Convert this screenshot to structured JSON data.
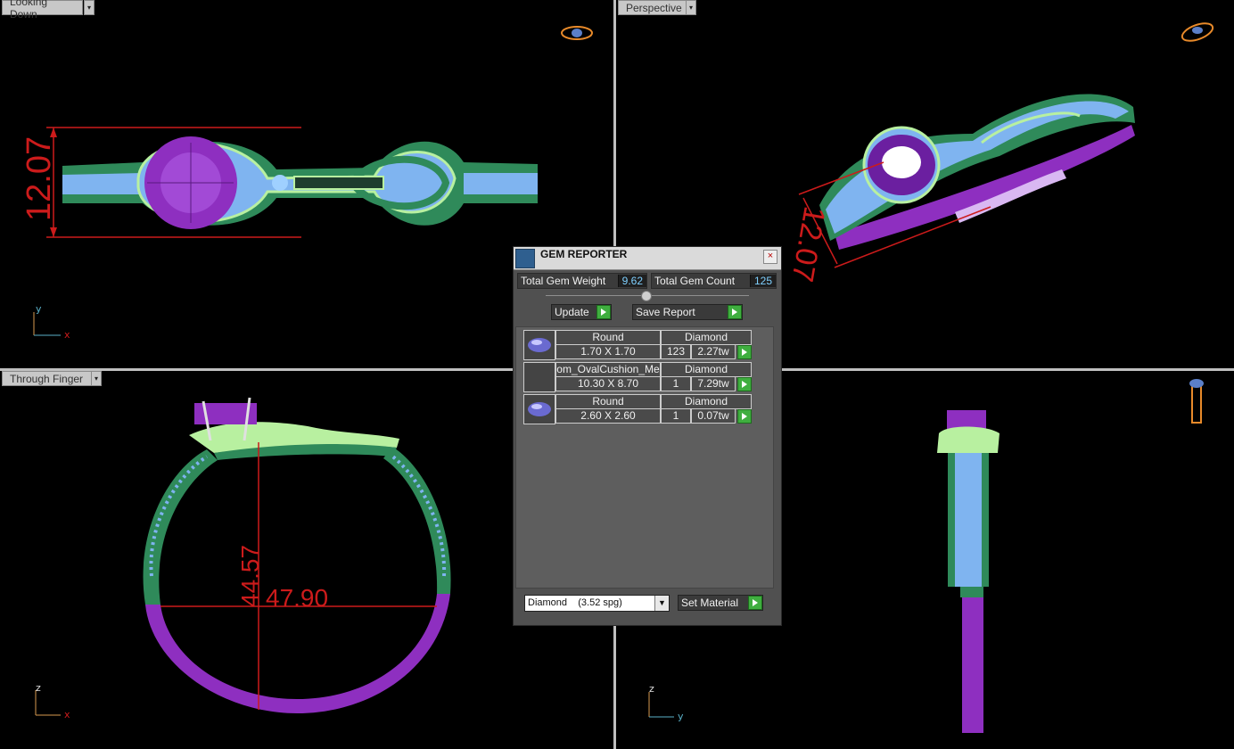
{
  "viewports": {
    "top_left": {
      "label": "Looking Down",
      "dimension": "12.07",
      "axis_a": "y",
      "axis_b": "x"
    },
    "top_right": {
      "label": "Perspective",
      "dimension": "12.07"
    },
    "bottom_left": {
      "label": "Through Finger",
      "dimension_height": "44.57",
      "dimension_width": "47.90",
      "axis_a": "z",
      "axis_b": "x"
    },
    "bottom_right": {
      "axis_a": "z",
      "axis_b": "y"
    }
  },
  "gem_reporter": {
    "title": "GEM REPORTER",
    "close": "×",
    "total_weight_label": "Total Gem Weight",
    "total_weight": "9.62",
    "total_count_label": "Total Gem Count",
    "total_count": "125",
    "update_label": "Update",
    "save_report_label": "Save Report",
    "rows": [
      {
        "shape": "Round",
        "material": "Diamond",
        "size": "1.70 X 1.70",
        "count": "123",
        "weight": "2.27tw",
        "thumb": "round-gem-icon"
      },
      {
        "shape": "om_OvalCushion_Me",
        "material": "Diamond",
        "size": "10.30 X 8.70",
        "count": "1",
        "weight": "7.29tw",
        "thumb": "blank"
      },
      {
        "shape": "Round",
        "material": "Diamond",
        "size": "2.60 X 2.60",
        "count": "1",
        "weight": "0.07tw",
        "thumb": "round-gem-icon"
      }
    ],
    "material_select": "Diamond    (3.52 spg)",
    "set_material_label": "Set Material"
  },
  "colors": {
    "dimension": "#cc1b1b",
    "band_green": "#2f8a5a",
    "band_blue": "#7fb4f0",
    "metal_purple": "#8e2fc0",
    "prong_green": "#b8f0a0"
  }
}
